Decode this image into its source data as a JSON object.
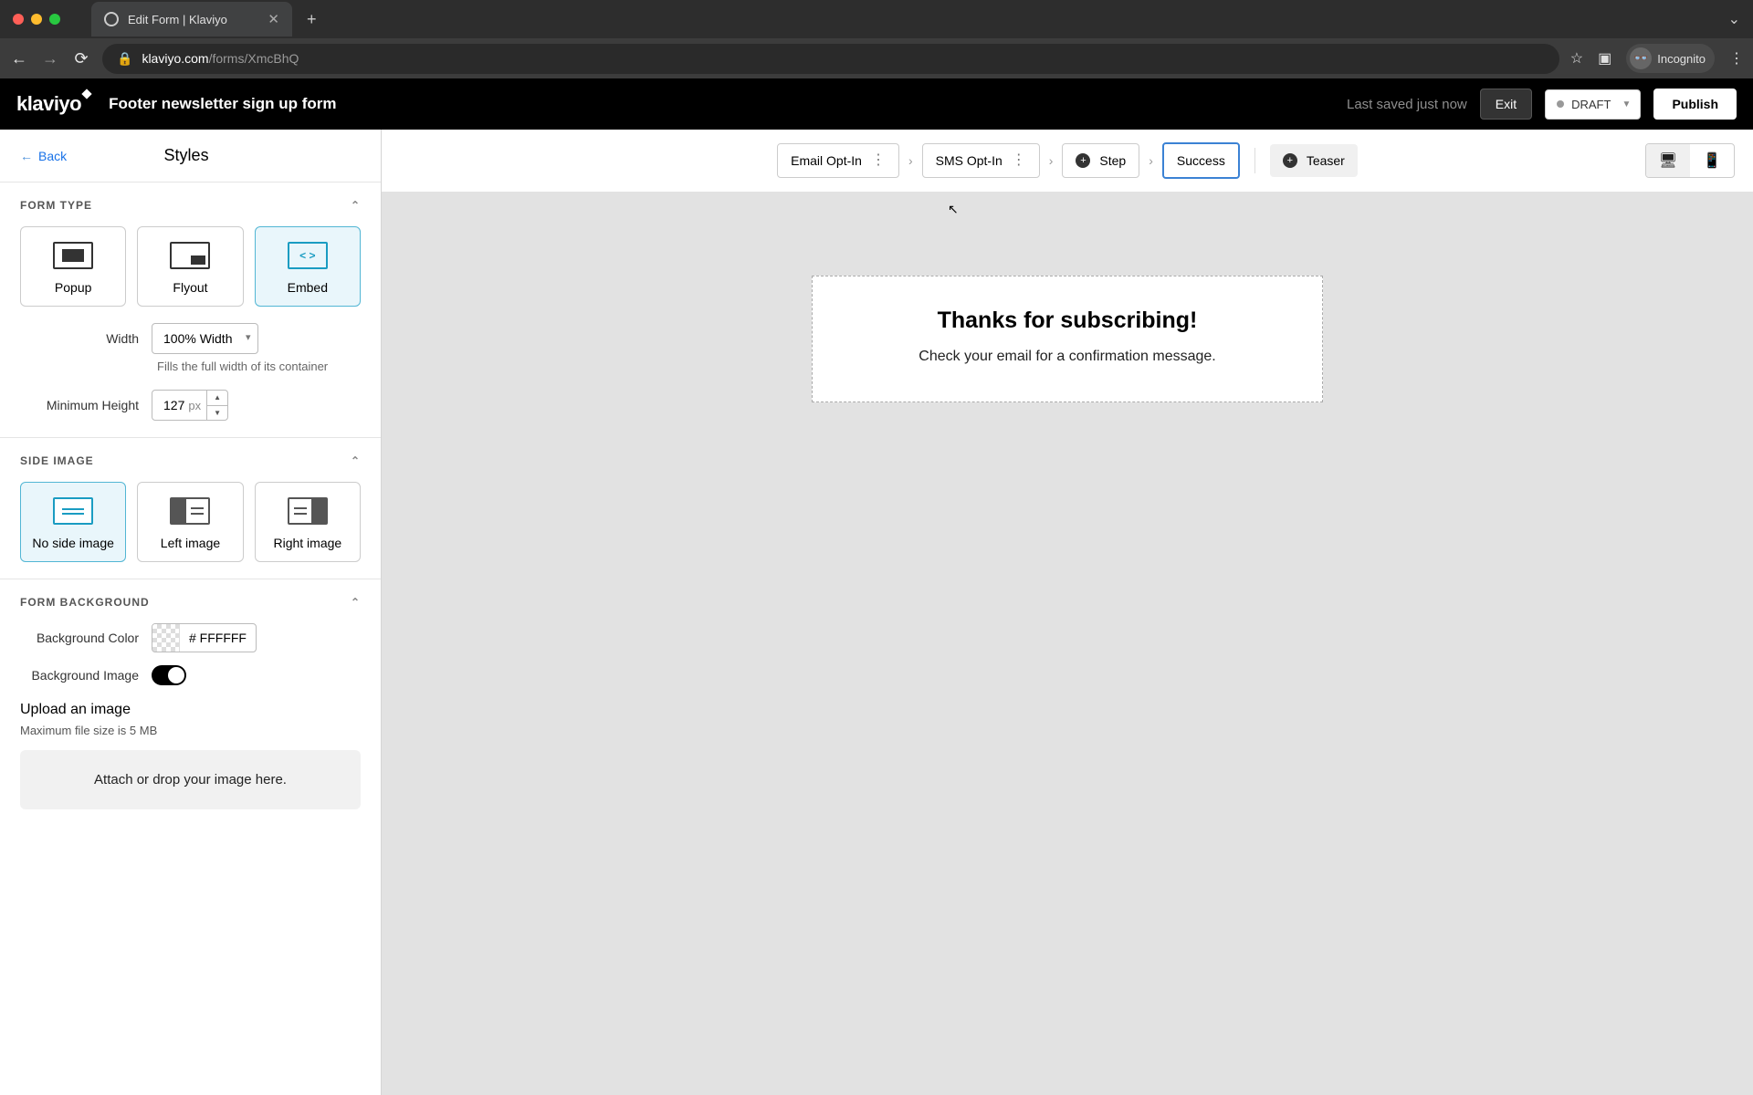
{
  "browser": {
    "tab_title": "Edit Form | Klaviyo",
    "url_host": "klaviyo.com",
    "url_path": "/forms/XmcBhQ",
    "incognito_label": "Incognito"
  },
  "header": {
    "logo": "klaviyo",
    "form_name": "Footer newsletter sign up form",
    "saved_text": "Last saved just now",
    "exit_label": "Exit",
    "status_label": "DRAFT",
    "publish_label": "Publish"
  },
  "sidebar": {
    "back_label": "Back",
    "title": "Styles",
    "form_type": {
      "header": "FORM TYPE",
      "options": {
        "popup": "Popup",
        "flyout": "Flyout",
        "embed": "Embed"
      },
      "width_label": "Width",
      "width_value": "100% Width",
      "width_hint": "Fills the full width of its container",
      "min_height_label": "Minimum Height",
      "min_height_value": "127",
      "min_height_unit": "px"
    },
    "side_image": {
      "header": "SIDE IMAGE",
      "options": {
        "none": "No side image",
        "left": "Left image",
        "right": "Right image"
      }
    },
    "background": {
      "header": "FORM BACKGROUND",
      "color_label": "Background Color",
      "color_value": "# FFFFFF",
      "image_label": "Background Image",
      "upload_title": "Upload an image",
      "upload_hint": "Maximum file size is 5 MB",
      "dropzone": "Attach or drop your image here."
    }
  },
  "steps": {
    "email": "Email Opt-In",
    "sms": "SMS Opt-In",
    "step": "Step",
    "success": "Success",
    "teaser": "Teaser"
  },
  "preview": {
    "heading": "Thanks for subscribing!",
    "body": "Check your email for a confirmation message."
  }
}
